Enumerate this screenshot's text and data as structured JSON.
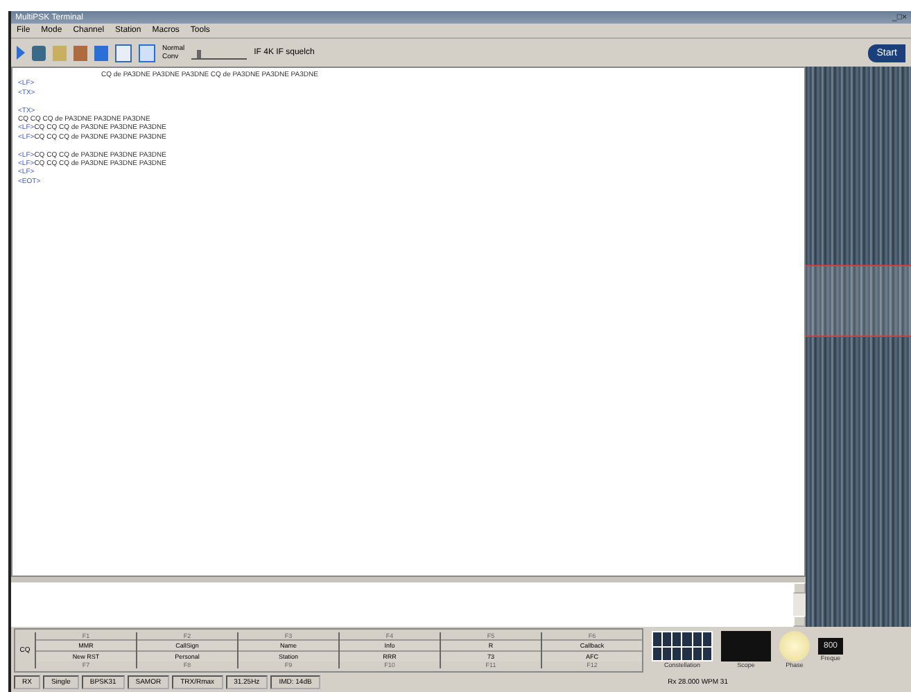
{
  "window": {
    "title": "MultiPSK Terminal",
    "controls": "_□×"
  },
  "menu": [
    "File",
    "Mode",
    "Channel",
    "Station",
    "Macros",
    "Tools"
  ],
  "toolbar": {
    "mode_label": "Normal\nConv",
    "squelch": {
      "level": 0.1
    },
    "readout": "IF 4K  IF squelch",
    "logo": "Start"
  },
  "receive": {
    "lines": [
      {
        "kind": "centered",
        "text": "CQ de PA3DNE PA3DNE PA3DNE CQ de PA3DNE PA3DNE PA3DNE"
      },
      {
        "kind": "tag",
        "text": "<LF>"
      },
      {
        "kind": "tag",
        "text": "<TX>"
      },
      {
        "kind": "blank"
      },
      {
        "kind": "tag",
        "text": "<TX>"
      },
      {
        "kind": "plain",
        "text": "CQ CQ CQ de PA3DNE PA3DNE PA3DNE"
      },
      {
        "kind": "mixed",
        "tag": "<LF>",
        "text": "CQ CQ CQ de PA3DNE PA3DNE PA3DNE"
      },
      {
        "kind": "mixed",
        "tag": "<LF>",
        "text": "CQ CQ CQ de PA3DNE PA3DNE PA3DNE"
      },
      {
        "kind": "blank"
      },
      {
        "kind": "mixed",
        "tag": "<LF>",
        "text": "CQ CQ CQ de PA3DNE PA3DNE PA3DNE"
      },
      {
        "kind": "mixed",
        "tag": "<LF>",
        "text": "CQ CQ CQ de PA3DNE PA3DNE PA3DNE"
      },
      {
        "kind": "tag",
        "text": "<LF>"
      },
      {
        "kind": "tag",
        "text": "<EOT>"
      }
    ]
  },
  "macros": {
    "side": "CQ",
    "keys": [
      {
        "top": "F1",
        "label": "MMR",
        "bottom_label": "New RST",
        "bottom": "F7"
      },
      {
        "top": "F2",
        "label": "CallSign",
        "bottom_label": "Personal",
        "bottom": "F8"
      },
      {
        "top": "F3",
        "label": "Name",
        "bottom_label": "Station",
        "bottom": "F9"
      },
      {
        "top": "F4",
        "label": "Info",
        "bottom_label": "RRR",
        "bottom": "F10"
      },
      {
        "top": "F5",
        "label": "R",
        "bottom_label": "73",
        "bottom": "F11"
      },
      {
        "top": "F6",
        "label": "Callback",
        "bottom_label": "AFC",
        "bottom": "F12"
      }
    ]
  },
  "displays": [
    {
      "kind": "constellation",
      "label": "Constellation"
    },
    {
      "kind": "scope",
      "label": "Scope"
    },
    {
      "kind": "phase",
      "label": "Phase"
    },
    {
      "kind": "frequency",
      "label": "Freque",
      "value": "800"
    }
  ],
  "status_bar": [
    "RX",
    "Single",
    "BPSK31",
    "SAMOR",
    "TRX/Rmax",
    "31.25Hz",
    "IMD: 14dB"
  ],
  "status_right": "Rx 28.000  WPM 31"
}
